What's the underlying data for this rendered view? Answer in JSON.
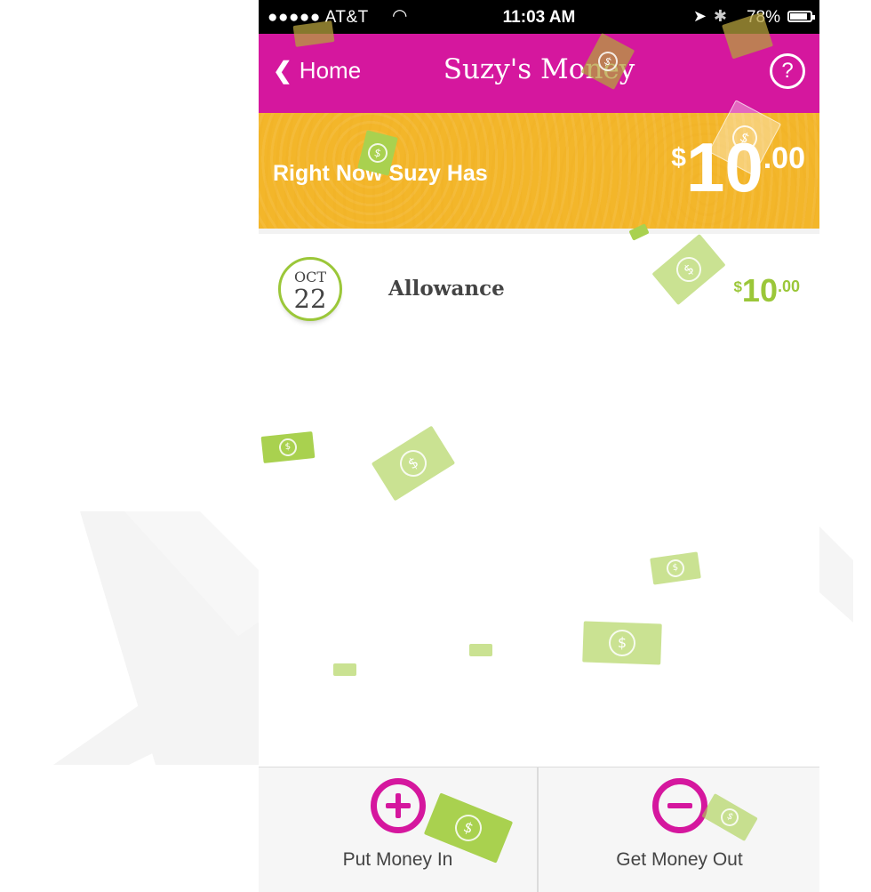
{
  "status_bar": {
    "carrier": "●●●●● AT&T",
    "time": "11:03 AM",
    "battery": "78%"
  },
  "nav": {
    "back_label": "Home",
    "title": "Suzy's Money",
    "help_label": "?"
  },
  "balance": {
    "label": "Right Now Suzy Has",
    "currency": "$",
    "whole": "10",
    "cents": ".00"
  },
  "transactions": [
    {
      "month": "OCT",
      "day": "22",
      "label": "Allowance",
      "currency": "$",
      "whole": "10",
      "cents": ".00"
    }
  ],
  "actions": {
    "put_in": "Put Money In",
    "get_out": "Get Money Out"
  },
  "icons": {
    "back": "chevron-left-icon",
    "help": "question-circle-icon",
    "put_in": "plus-circle-icon",
    "get_out": "minus-circle-icon",
    "bill": "dollar-bill-icon"
  },
  "colors": {
    "brand_magenta": "#d5179e",
    "balance_yellow": "#f3b62a",
    "money_green": "#9bc739"
  }
}
